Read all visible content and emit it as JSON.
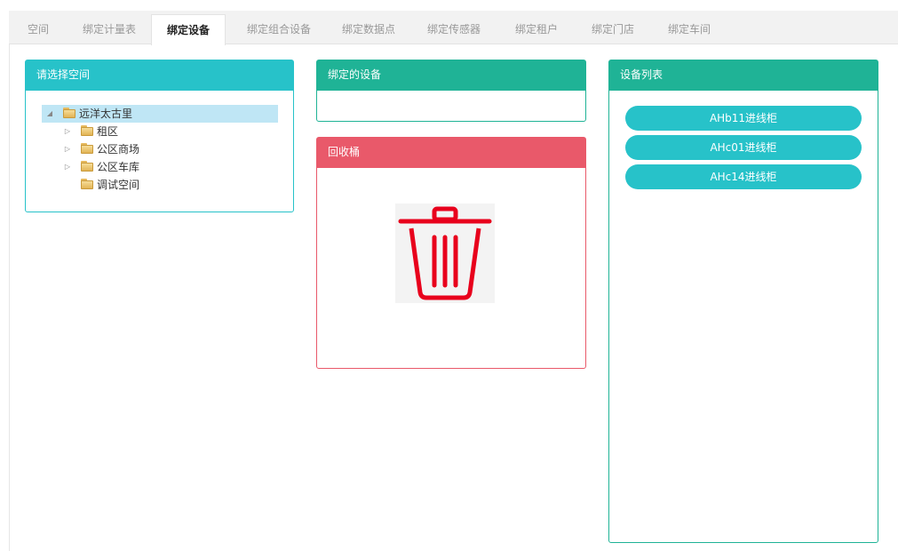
{
  "tabs": [
    {
      "label": "空间"
    },
    {
      "label": "绑定计量表"
    },
    {
      "label": "绑定设备"
    },
    {
      "label": "绑定组合设备"
    },
    {
      "label": "绑定数据点"
    },
    {
      "label": "绑定传感器"
    },
    {
      "label": "绑定租户"
    },
    {
      "label": "绑定门店"
    },
    {
      "label": "绑定车间"
    }
  ],
  "active_tab": "绑定设备",
  "space_panel": {
    "title": "请选择空间",
    "tree": {
      "root": {
        "label": "远洋太古里",
        "expanded": true,
        "selected": true
      },
      "children": [
        {
          "label": "租区",
          "has_children": true
        },
        {
          "label": "公区商场",
          "has_children": true
        },
        {
          "label": "公区车库",
          "has_children": true
        },
        {
          "label": "调试空间",
          "has_children": false
        }
      ]
    }
  },
  "bound_panel": {
    "title": "绑定的设备"
  },
  "trash_panel": {
    "title": "回收桶",
    "icon": "trash-icon"
  },
  "devices_panel": {
    "title": "设备列表",
    "items": [
      {
        "label": "AHb11进线柜"
      },
      {
        "label": "AHc01进线柜"
      },
      {
        "label": "AHc14进线柜"
      }
    ]
  },
  "colors": {
    "cyan": "#27c2c9",
    "green": "#1fb396",
    "red": "#e9596a",
    "trash_icon": "#e8001c"
  }
}
